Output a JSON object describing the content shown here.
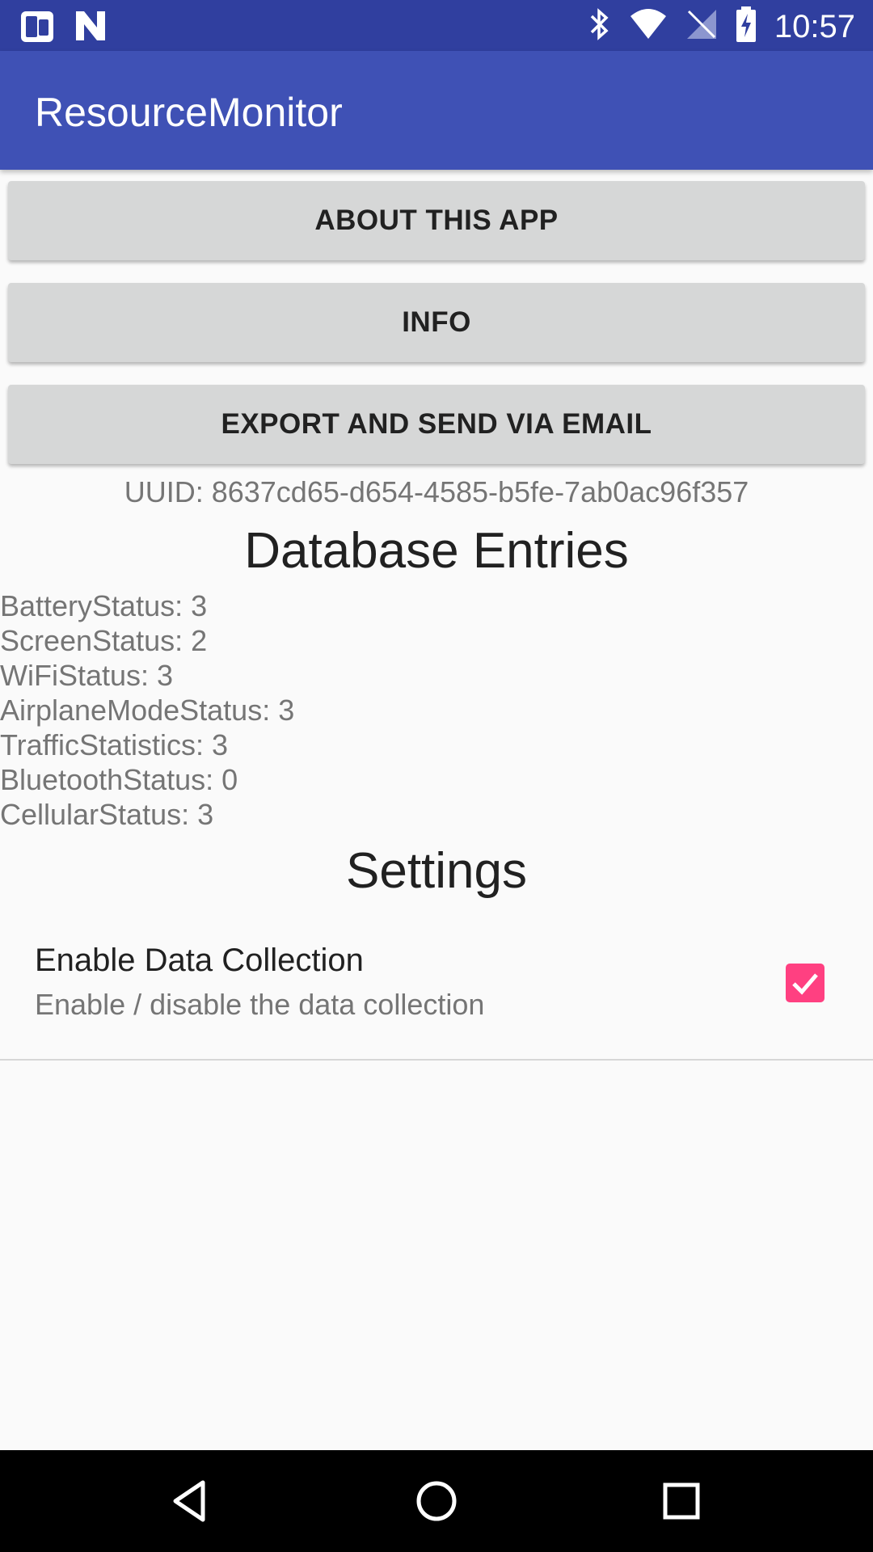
{
  "status_bar": {
    "time": "10:57",
    "left_icons": [
      "phone-status-icon",
      "n-notification-icon"
    ],
    "right_icons": [
      "bluetooth-icon",
      "wifi-icon",
      "no-signal-icon",
      "battery-charging-icon"
    ]
  },
  "app_bar": {
    "title": "ResourceMonitor",
    "color": "#3f51b5"
  },
  "buttons": {
    "about": "ABOUT THIS APP",
    "info": "INFO",
    "export": "EXPORT AND SEND VIA EMAIL"
  },
  "uuid": "UUID: 8637cd65-d654-4585-b5fe-7ab0ac96f357",
  "database": {
    "heading": "Database Entries",
    "entries": [
      "BatteryStatus: 3",
      "ScreenStatus: 2",
      "WiFiStatus: 3",
      "AirplaneModeStatus: 3",
      "TrafficStatistics: 3",
      "BluetoothStatus: 0",
      "CellularStatus: 3"
    ]
  },
  "settings": {
    "heading": "Settings",
    "data_collection": {
      "title": "Enable Data Collection",
      "summary": "Enable / disable the data collection",
      "checked": true,
      "accent": "#ff4081"
    }
  },
  "nav_bar": {
    "icons": [
      "back-icon",
      "home-icon",
      "recents-icon"
    ]
  }
}
